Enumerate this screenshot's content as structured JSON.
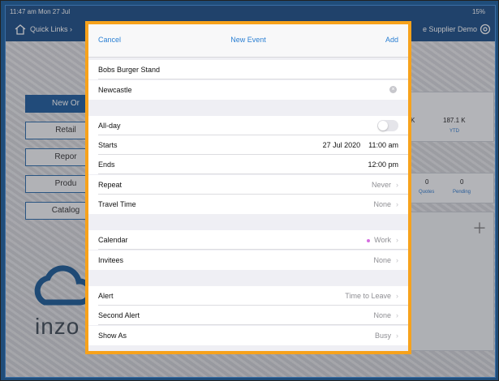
{
  "statusbar": {
    "time": "11:47 am  Mon 27 Jul",
    "battery": "15%"
  },
  "navbar": {
    "quick_links": "Quick Links ›",
    "supplier": "e Supplier Demo"
  },
  "sidebar": {
    "items": [
      {
        "label": "New Or"
      },
      {
        "label": "Retail"
      },
      {
        "label": "Repor"
      },
      {
        "label": "Produ"
      },
      {
        "label": "Catalog"
      }
    ]
  },
  "stats": {
    "left_value": "K",
    "ytd_value": "187.1 K",
    "ytd_label": "YTD"
  },
  "counts": {
    "quotes_value": "0",
    "quotes_label": "Quotes",
    "pending_value": "0",
    "pending_label": "Pending"
  },
  "brand": {
    "logo_text": "inzo"
  },
  "sheet": {
    "cancel": "Cancel",
    "title": "New Event",
    "add": "Add",
    "event_title": "Bobs Burger Stand",
    "location": "Newcastle",
    "all_day": "All-day",
    "starts_label": "Starts",
    "starts_date": "27 Jul 2020",
    "starts_time": "11:00 am",
    "ends_label": "Ends",
    "ends_time": "12:00 pm",
    "repeat_label": "Repeat",
    "repeat_value": "Never",
    "travel_label": "Travel Time",
    "travel_value": "None",
    "calendar_label": "Calendar",
    "calendar_value": "Work",
    "invitees_label": "Invitees",
    "invitees_value": "None",
    "alert_label": "Alert",
    "alert_value": "Time to Leave",
    "second_alert_label": "Second Alert",
    "second_alert_value": "None",
    "show_as_label": "Show As",
    "show_as_value": "Busy"
  },
  "colors": {
    "accent": "#2a7fd3",
    "highlight_border": "#f7a21b",
    "nav": "#1d4f86",
    "calendar_dot": "#d56ee0"
  },
  "icons": {
    "home": "home-icon",
    "settings": "gear-icon",
    "clear": "clear-icon",
    "chevron": "chevron-right-icon"
  }
}
